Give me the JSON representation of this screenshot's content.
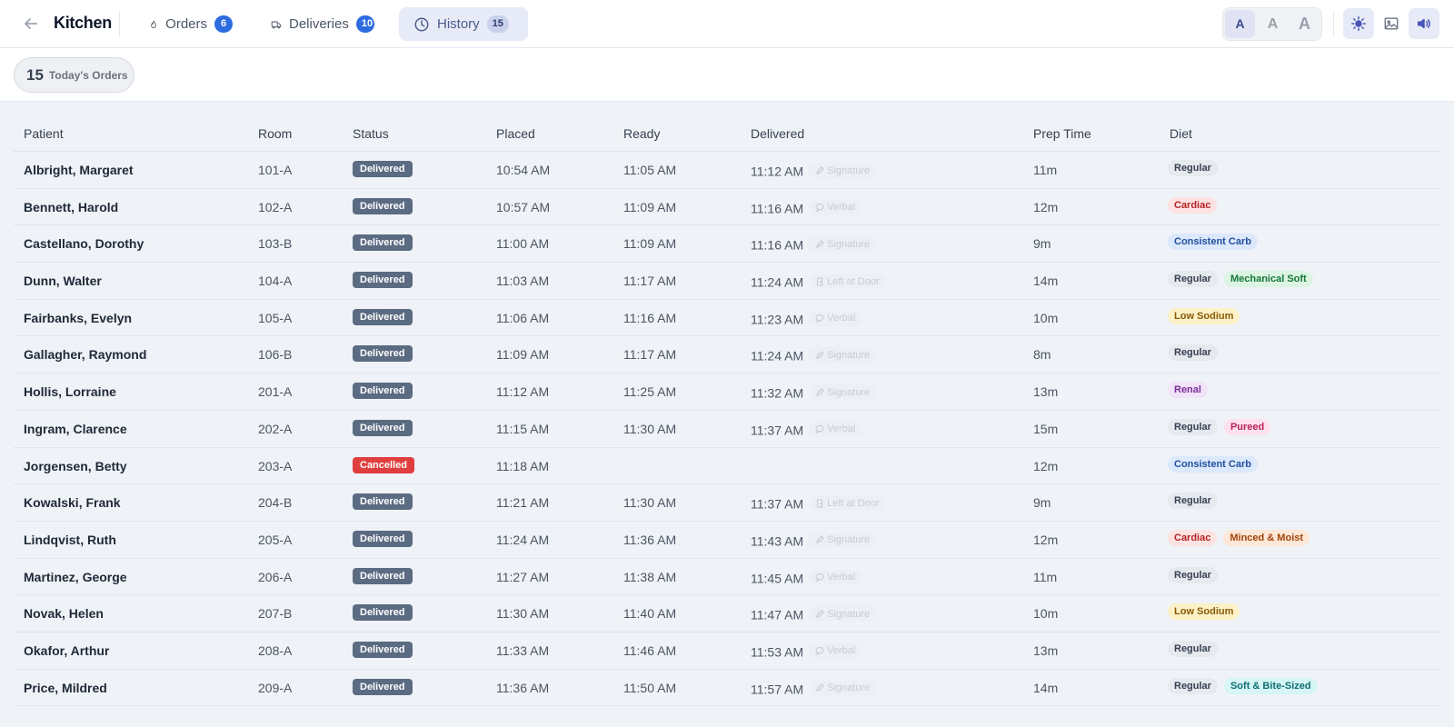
{
  "app": {
    "title": "Kitchen"
  },
  "tabs": [
    {
      "label": "Orders",
      "count": "6"
    },
    {
      "label": "Deliveries",
      "count": "10"
    },
    {
      "label": "History",
      "count": "15"
    }
  ],
  "font_size_options": [
    "A",
    "A",
    "A"
  ],
  "summary": {
    "count": "15",
    "label": "Today's Orders"
  },
  "columns": [
    "Patient",
    "Room",
    "Status",
    "Placed",
    "Ready",
    "Delivered",
    "Prep Time",
    "Diet"
  ],
  "diet_colors": {
    "Regular": {
      "bg": "#e6e9ee",
      "fg": "#374151"
    },
    "Cardiac": {
      "bg": "#fde2e2",
      "fg": "#b42323"
    },
    "Consistent Carb": {
      "bg": "#dce8fb",
      "fg": "#1f4f9f"
    },
    "Mechanical Soft": {
      "bg": "#dcf5e3",
      "fg": "#17753a"
    },
    "Low Sodium": {
      "bg": "#fcf1c7",
      "fg": "#8a5a07"
    },
    "Renal": {
      "bg": "#f1e3fa",
      "fg": "#7b2d97"
    },
    "Pureed": {
      "bg": "#fde1ec",
      "fg": "#b81f5b"
    },
    "Minced & Moist": {
      "bg": "#fde7d6",
      "fg": "#a2440c"
    },
    "Soft & Bite-Sized": {
      "bg": "#d6f5f5",
      "fg": "#0f6f73"
    }
  },
  "rows": [
    {
      "patient": "Albright, Margaret",
      "room": "101-A",
      "status": "Delivered",
      "placed": "10:54 AM",
      "ready": "11:05 AM",
      "delivered": "11:12 AM",
      "method": "Signature",
      "method_icon": "pen-icon",
      "prep": "11m",
      "diets": [
        "Regular"
      ]
    },
    {
      "patient": "Bennett, Harold",
      "room": "102-A",
      "status": "Delivered",
      "placed": "10:57 AM",
      "ready": "11:09 AM",
      "delivered": "11:16 AM",
      "method": "Verbal",
      "method_icon": "speech-icon",
      "prep": "12m",
      "diets": [
        "Cardiac"
      ]
    },
    {
      "patient": "Castellano, Dorothy",
      "room": "103-B",
      "status": "Delivered",
      "placed": "11:00 AM",
      "ready": "11:09 AM",
      "delivered": "11:16 AM",
      "method": "Signature",
      "method_icon": "pen-icon",
      "prep": "9m",
      "diets": [
        "Consistent Carb"
      ]
    },
    {
      "patient": "Dunn, Walter",
      "room": "104-A",
      "status": "Delivered",
      "placed": "11:03 AM",
      "ready": "11:17 AM",
      "delivered": "11:24 AM",
      "method": "Left at Door",
      "method_icon": "door-icon",
      "prep": "14m",
      "diets": [
        "Regular",
        "Mechanical Soft"
      ]
    },
    {
      "patient": "Fairbanks, Evelyn",
      "room": "105-A",
      "status": "Delivered",
      "placed": "11:06 AM",
      "ready": "11:16 AM",
      "delivered": "11:23 AM",
      "method": "Verbal",
      "method_icon": "speech-icon",
      "prep": "10m",
      "diets": [
        "Low Sodium"
      ]
    },
    {
      "patient": "Gallagher, Raymond",
      "room": "106-B",
      "status": "Delivered",
      "placed": "11:09 AM",
      "ready": "11:17 AM",
      "delivered": "11:24 AM",
      "method": "Signature",
      "method_icon": "pen-icon",
      "prep": "8m",
      "diets": [
        "Regular"
      ]
    },
    {
      "patient": "Hollis, Lorraine",
      "room": "201-A",
      "status": "Delivered",
      "placed": "11:12 AM",
      "ready": "11:25 AM",
      "delivered": "11:32 AM",
      "method": "Signature",
      "method_icon": "pen-icon",
      "prep": "13m",
      "diets": [
        "Renal"
      ]
    },
    {
      "patient": "Ingram, Clarence",
      "room": "202-A",
      "status": "Delivered",
      "placed": "11:15 AM",
      "ready": "11:30 AM",
      "delivered": "11:37 AM",
      "method": "Verbal",
      "method_icon": "speech-icon",
      "prep": "15m",
      "diets": [
        "Regular",
        "Pureed"
      ]
    },
    {
      "patient": "Jorgensen, Betty",
      "room": "203-A",
      "status": "Cancelled",
      "placed": "11:18 AM",
      "ready": "",
      "delivered": "",
      "method": "",
      "method_icon": "",
      "prep": "12m",
      "diets": [
        "Consistent Carb"
      ]
    },
    {
      "patient": "Kowalski, Frank",
      "room": "204-B",
      "status": "Delivered",
      "placed": "11:21 AM",
      "ready": "11:30 AM",
      "delivered": "11:37 AM",
      "method": "Left at Door",
      "method_icon": "door-icon",
      "prep": "9m",
      "diets": [
        "Regular"
      ]
    },
    {
      "patient": "Lindqvist, Ruth",
      "room": "205-A",
      "status": "Delivered",
      "placed": "11:24 AM",
      "ready": "11:36 AM",
      "delivered": "11:43 AM",
      "method": "Signature",
      "method_icon": "pen-icon",
      "prep": "12m",
      "diets": [
        "Cardiac",
        "Minced & Moist"
      ]
    },
    {
      "patient": "Martinez, George",
      "room": "206-A",
      "status": "Delivered",
      "placed": "11:27 AM",
      "ready": "11:38 AM",
      "delivered": "11:45 AM",
      "method": "Verbal",
      "method_icon": "speech-icon",
      "prep": "11m",
      "diets": [
        "Regular"
      ]
    },
    {
      "patient": "Novak, Helen",
      "room": "207-B",
      "status": "Delivered",
      "placed": "11:30 AM",
      "ready": "11:40 AM",
      "delivered": "11:47 AM",
      "method": "Signature",
      "method_icon": "pen-icon",
      "prep": "10m",
      "diets": [
        "Low Sodium"
      ]
    },
    {
      "patient": "Okafor, Arthur",
      "room": "208-A",
      "status": "Delivered",
      "placed": "11:33 AM",
      "ready": "11:46 AM",
      "delivered": "11:53 AM",
      "method": "Verbal",
      "method_icon": "speech-icon",
      "prep": "13m",
      "diets": [
        "Regular"
      ]
    },
    {
      "patient": "Price, Mildred",
      "room": "209-A",
      "status": "Delivered",
      "placed": "11:36 AM",
      "ready": "11:50 AM",
      "delivered": "11:57 AM",
      "method": "Signature",
      "method_icon": "pen-icon",
      "prep": "14m",
      "diets": [
        "Regular",
        "Soft & Bite-Sized"
      ]
    }
  ]
}
